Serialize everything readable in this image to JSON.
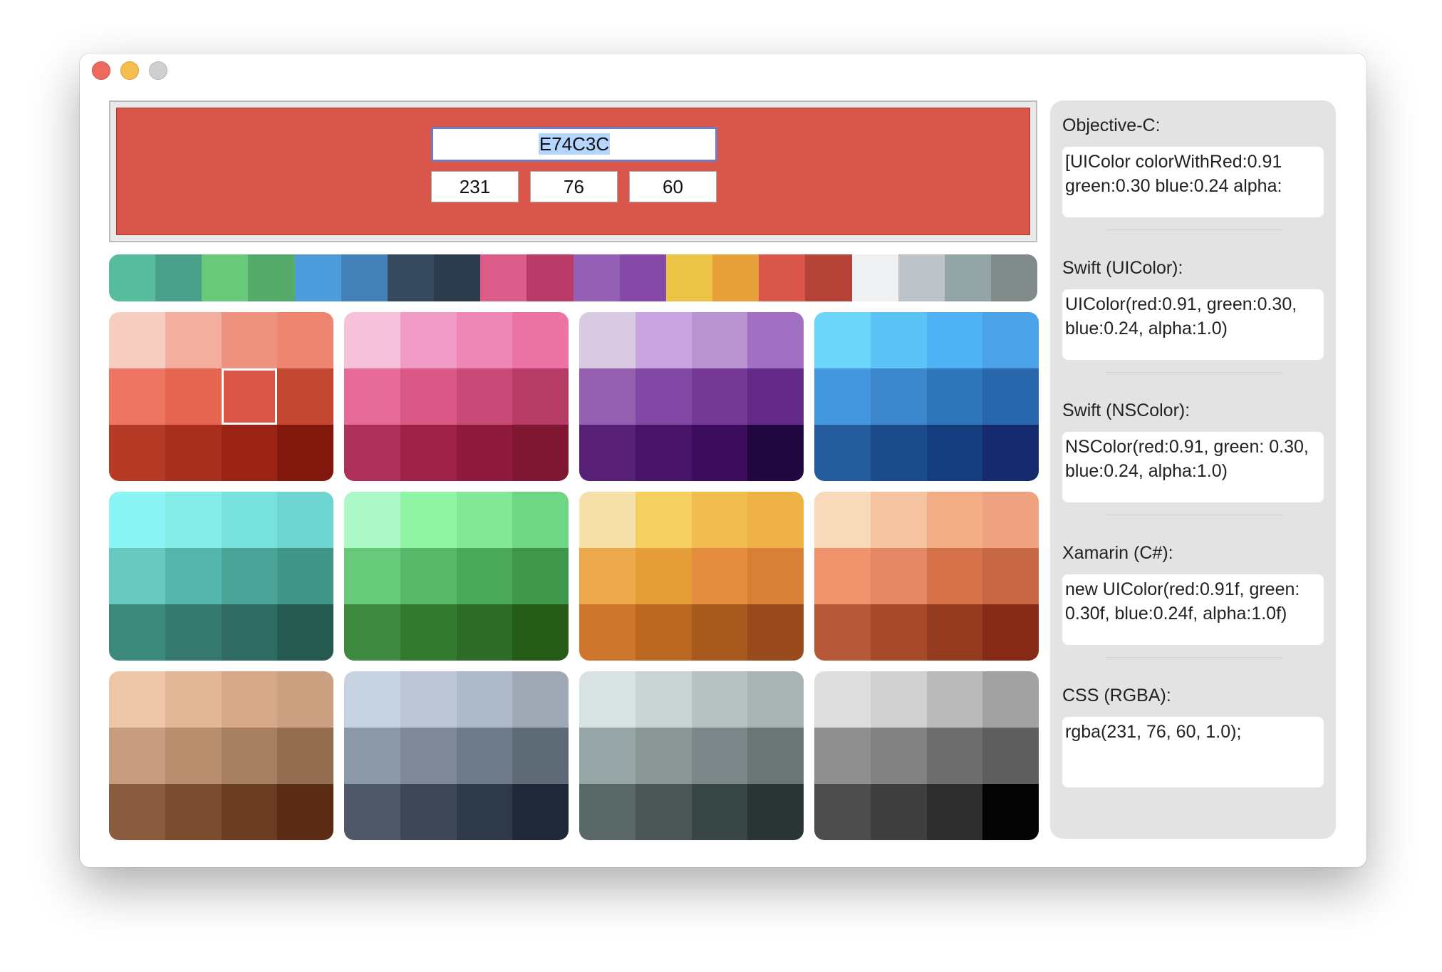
{
  "window": {
    "controls": [
      "close",
      "minimize",
      "zoom"
    ]
  },
  "preview": {
    "color": "#d9574a",
    "hex_value": "E74C3C",
    "rgb": {
      "r": "231",
      "g": "76",
      "b": "60"
    }
  },
  "strip_colors": [
    "#56bc9d",
    "#4aa189",
    "#68c97a",
    "#54ab6a",
    "#4d9cdc",
    "#4280b7",
    "#34495e",
    "#2d3c4c",
    "#db5c88",
    "#bb3b68",
    "#9360b6",
    "#8549a7",
    "#ebc445",
    "#e79f39",
    "#d9574a",
    "#b44236",
    "#eef0f1",
    "#bec3c7",
    "#94a5a5",
    "#818b8c"
  ],
  "palettes": [
    [
      "#f6cec2",
      "#f2ae9e",
      "#ef9381",
      "#ee8570",
      "#ef7563",
      "#e66550",
      "#da5747",
      "#c44732",
      "#b63b27",
      "#a82e1e",
      "#9b2313",
      "#82180d"
    ],
    [
      "#f5c2d9",
      "#f19cc7",
      "#ef87b6",
      "#ec74a4",
      "#e66b98",
      "#da5886",
      "#c84a76",
      "#b63c66",
      "#ad2f5a",
      "#9e2248",
      "#8f1a3d",
      "#7f1632"
    ],
    [
      "#d8cae0",
      "#c8a5e0",
      "#b794d0",
      "#a170c3",
      "#955fb0",
      "#8248a6",
      "#733894",
      "#642a88",
      "#572076",
      "#48146a",
      "#3b0d5c",
      "#220841"
    ],
    [
      "#6cd5fa",
      "#5cc3f7",
      "#4fb2f5",
      "#4ba2e7",
      "#4297df",
      "#3d87cc",
      "#2f75ba",
      "#2867ac",
      "#245c9d",
      "#1c4b8c",
      "#133d7d",
      "#152b6e"
    ],
    [
      "#8af5f4",
      "#83ece6",
      "#77e2dd",
      "#6fd5d0",
      "#68c9c1",
      "#56b6ad",
      "#4aa498",
      "#41968a",
      "#3c8a7c",
      "#35786e",
      "#2f6b62",
      "#255a51"
    ],
    [
      "#abf8c6",
      "#8ff4a3",
      "#82e898",
      "#6fd685",
      "#67c97a",
      "#59b96b",
      "#4ba95b",
      "#3f974b",
      "#3e8a40",
      "#327b2e",
      "#2c6c26",
      "#265c17"
    ],
    [
      "#f6e0aa",
      "#f5cf62",
      "#f0bc50",
      "#eeb247",
      "#eba94b",
      "#e69f38",
      "#e58d3f",
      "#d98037",
      "#cd762c",
      "#b96721",
      "#a6581d",
      "#994b1e"
    ],
    [
      "#f8d9b9",
      "#f5c39f",
      "#f2ad86",
      "#efa27f",
      "#ef946c",
      "#e38764",
      "#d57249",
      "#c86744",
      "#b65938",
      "#a84a2a",
      "#953b1f",
      "#872a17"
    ],
    [
      "#ecc6a6",
      "#e1b797",
      "#d6a888",
      "#cca181",
      "#c69d7e",
      "#b98e6e",
      "#a67e61",
      "#946c4f",
      "#895c3f",
      "#7a4c30",
      "#6a3d23",
      "#5b2c14"
    ],
    [
      "#c7d3e0",
      "#bcc6d4",
      "#aebac7",
      "#9fa9b5",
      "#8b98a8",
      "#7e8897",
      "#6e7a89",
      "#5f6a77",
      "#4e5868",
      "#3e4756",
      "#2f3a48",
      "#1f2838"
    ],
    [
      "#d8e2e2",
      "#c8d4d3",
      "#b6c2c2",
      "#a8b3b3",
      "#96a5a5",
      "#8a9595",
      "#7a8687",
      "#6a7575",
      "#596767",
      "#4b5656",
      "#384645",
      "#2a3535"
    ],
    [
      "#dedede",
      "#d1d1d1",
      "#bababa",
      "#a2a2a2",
      "#8f8f8f",
      "#828282",
      "#6e6e6e",
      "#5f5f5f",
      "#4d4d4d",
      "#3f3f3f",
      "#2d2d2d",
      "#040404"
    ]
  ],
  "selected_swatch": {
    "palette": 0,
    "index": 6
  },
  "code": [
    {
      "title": "Objective-C:",
      "code": "[UIColor colorWithRed:0.91 green:0.30 blue:0.24 alpha:"
    },
    {
      "title": "Swift (UIColor):",
      "code": "UIColor(red:0.91, green:0.30, blue:0.24, alpha:1.0)"
    },
    {
      "title": "Swift (NSColor):",
      "code": "NSColor(red:0.91, green: 0.30, blue:0.24, alpha:1.0)"
    },
    {
      "title": "Xamarin (C#):",
      "code": "new UIColor(red:0.91f, green: 0.30f, blue:0.24f, alpha:1.0f)"
    },
    {
      "title": "CSS (RGBA):",
      "code": "rgba(231, 76, 60, 1.0);"
    }
  ]
}
